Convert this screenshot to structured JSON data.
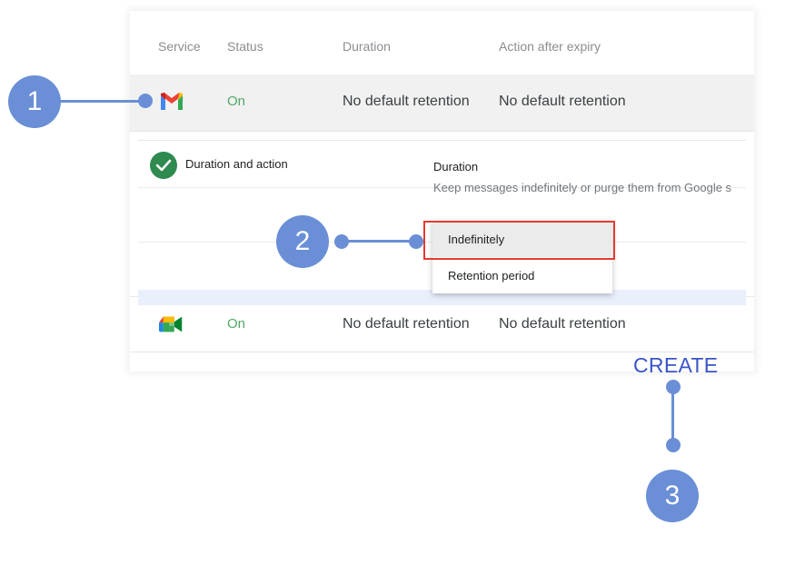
{
  "table": {
    "headers": {
      "service": "Service",
      "status": "Status",
      "duration": "Duration",
      "action": "Action after expiry"
    },
    "rows": [
      {
        "service_icon": "gmail-icon",
        "status": "On",
        "duration": "No default retention",
        "action": "No default retention"
      },
      {
        "service_icon": "meet-icon",
        "status": "On",
        "duration": "No default retention",
        "action": "No default retention"
      }
    ]
  },
  "expanded": {
    "section_label": "Duration and action",
    "duration_title": "Duration",
    "duration_desc": "Keep messages indefinitely or purge them from Google s",
    "options": [
      "Indefinitely",
      "Retention period"
    ],
    "selected_option": "Indefinitely"
  },
  "callouts": {
    "one": "1",
    "two": "2",
    "three": "3"
  },
  "create_label": "CREATE",
  "colors": {
    "callout": "#6a8fd6",
    "highlight": "#e53a31",
    "status_on": "#52a866",
    "create": "#3b55c9",
    "check": "#2e8a4f"
  }
}
